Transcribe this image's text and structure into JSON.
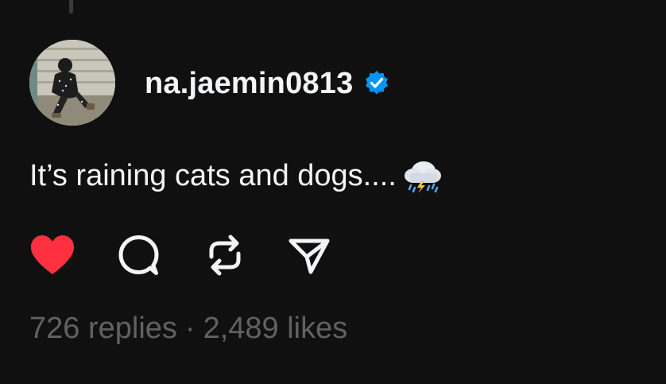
{
  "post": {
    "username": "na.jaemin0813",
    "text": "It’s raining cats and dogs....",
    "emoji": "cloud-with-lightning-and-rain",
    "verified": true
  },
  "actions": {
    "like_icon": "heart-icon",
    "liked": true,
    "reply_icon": "comment-icon",
    "repost_icon": "repost-icon",
    "share_icon": "send-icon"
  },
  "stats": {
    "replies": "726 replies",
    "separator": "·",
    "likes": "2,489 likes"
  },
  "colors": {
    "background": "#101010",
    "text": "#f3f5f7",
    "muted": "#616161",
    "like": "#ff3040",
    "verified": "#0095f6"
  }
}
